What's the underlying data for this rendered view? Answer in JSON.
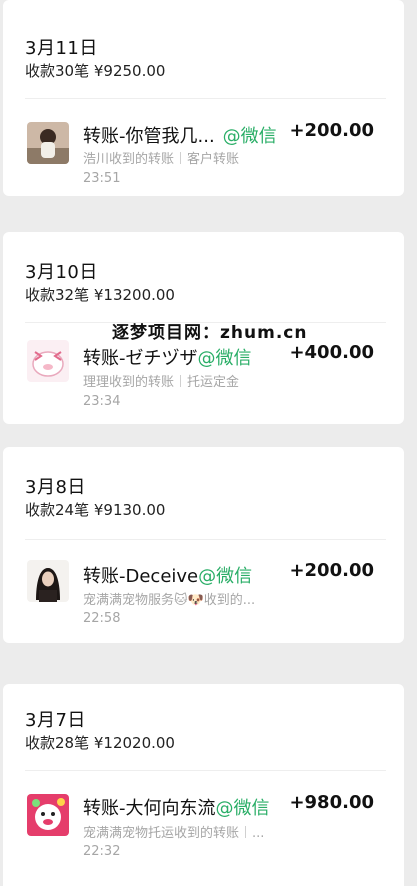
{
  "watermark": "逐梦项目网：zhum.cn",
  "days": [
    {
      "date": "3月11日",
      "summary": "收款30笔 ¥9250.00",
      "tx": {
        "title": "转账-你管我几...",
        "source": "@微信",
        "amount": "+200.00",
        "sub_left": "浩川收到的转账",
        "sub_right": "客户转账",
        "time": "23:51"
      }
    },
    {
      "date": "3月10日",
      "summary": "收款32笔 ¥13200.00",
      "tx": {
        "title": "转账-ゼチヅザ",
        "source": "@微信",
        "amount": "+400.00",
        "sub_left": "理理收到的转账",
        "sub_right": "托运定金",
        "time": "23:34"
      }
    },
    {
      "date": "3月8日",
      "summary": "收款24笔 ¥9130.00",
      "tx": {
        "title": "转账-Deceive",
        "source": "@微信",
        "amount": "+200.00",
        "sub_left": "宠满满宠物服务🐱🐶收到的...",
        "sub_right": "",
        "time": "22:58"
      }
    },
    {
      "date": "3月7日",
      "summary": "收款28笔 ¥12020.00",
      "tx": {
        "title": "转账-大何向东流",
        "source": "@微信",
        "amount": "+980.00",
        "sub_left": "宠满满宠物托运收到的转账",
        "sub_right": "...",
        "time": "22:32"
      }
    }
  ]
}
